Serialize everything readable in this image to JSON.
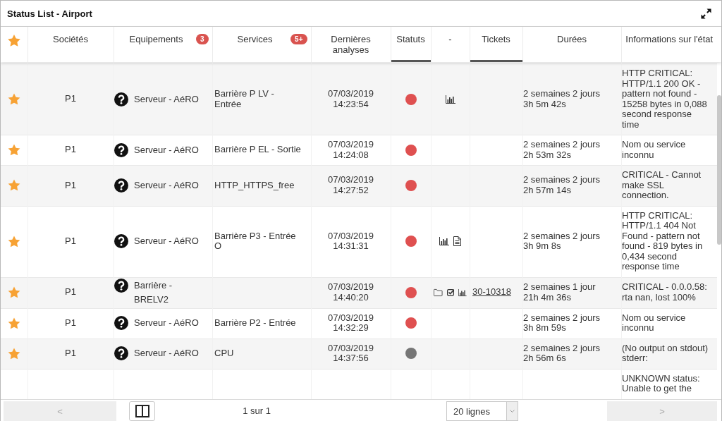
{
  "window": {
    "title": "Status List - Airport"
  },
  "table": {
    "columns": [
      {
        "kind": "favorite",
        "active": false
      },
      {
        "kind": "text",
        "label": "Sociétés",
        "active": false
      },
      {
        "kind": "text",
        "label": "Equipements",
        "badge": "3",
        "active": false
      },
      {
        "kind": "text",
        "label": "Services",
        "badge": "5+",
        "active": false
      },
      {
        "kind": "text",
        "label": "Dernières analyses",
        "active": false
      },
      {
        "kind": "text",
        "label": "Statuts",
        "active": true
      },
      {
        "kind": "text",
        "label": "-",
        "active": false
      },
      {
        "kind": "text",
        "label": "Tickets",
        "active": true
      },
      {
        "kind": "text",
        "label": "Durées",
        "active": false
      },
      {
        "kind": "text",
        "label": "Informations sur l'état",
        "active": false
      }
    ],
    "rows": [
      {
        "favorite": true,
        "company": "P1",
        "equipment": "Serveur - AéRO",
        "service": "Barrière P LV - Entrée",
        "last_check": "07/03/2019 14:23:54",
        "color": "#df5050",
        "actions": [
          {
            "kind": "chart"
          }
        ],
        "duration": "2 semaines 2 jours 3h 5m 42s",
        "info": "HTTP CRITICAL: HTTP/1.1 200 OK - pattern not found - 15258 bytes in 0,088 second response time"
      },
      {
        "favorite": true,
        "company": "P1",
        "equipment": "Serveur - AéRO",
        "service": "Barrière P EL - Sortie",
        "last_check": "07/03/2019 14:24:08",
        "color": "#df5050",
        "duration": "2 semaines 2 jours 2h 53m 32s",
        "info": "Nom ou service inconnu"
      },
      {
        "favorite": true,
        "company": "P1",
        "equipment": "Serveur - AéRO",
        "service": "HTTP_HTTPS_free",
        "last_check": "07/03/2019 14:27:52",
        "color": "#df5050",
        "duration": "2 semaines 2 jours 2h 57m 14s",
        "info": "CRITICAL - Cannot make SSL connection."
      },
      {
        "favorite": true,
        "company": "P1",
        "equipment": "Serveur - AéRO",
        "service": "Barrière P3 - Entrée O",
        "last_check": "07/03/2019 14:31:31",
        "color": "#df5050",
        "actions": [
          {
            "kind": "chart"
          },
          {
            "kind": "report"
          }
        ],
        "duration": "2 semaines 2 jours 3h 9m 8s",
        "info": "HTTP CRITICAL: HTTP/1.1 404 Not Found - pattern not found - 819 bytes in 0,434 second response time"
      },
      {
        "favorite": true,
        "company": "P1",
        "equipment": "Barrière - BRELV2",
        "last_check": "07/03/2019 14:40:20",
        "color": "#df5050",
        "actions": [
          {
            "kind": "folder"
          },
          {
            "kind": "checklist"
          },
          {
            "kind": "chart"
          }
        ],
        "ticket": "30-10318",
        "duration": "2 semaines 1 jour 21h 4m 36s",
        "info": "CRITICAL - 0.0.0.58: rta nan, lost 100%"
      },
      {
        "favorite": true,
        "company": "P1",
        "equipment": "Serveur - AéRO",
        "service": "Barrière P2 - Entrée",
        "last_check": "07/03/2019 14:32:29",
        "color": "#df5050",
        "duration": "2 semaines 2 jours 3h 8m 59s",
        "info": "Nom ou service inconnu"
      },
      {
        "favorite": true,
        "company": "P1",
        "equipment": "Serveur - AéRO",
        "service": "CPU",
        "last_check": "07/03/2019 14:37:56",
        "color": "#767676",
        "duration": "2 semaines 2 jours 2h 56m 6s",
        "info": "(No output on stdout) stderr:"
      },
      {
        "info": "UNKNOWN status: Unable to get the"
      }
    ]
  },
  "pager": {
    "previous": {
      "label": "<",
      "disabled": true
    },
    "page_info": "1 sur 1",
    "page_size": "20 lignes",
    "next": {
      "label": ">",
      "disabled": true
    }
  }
}
